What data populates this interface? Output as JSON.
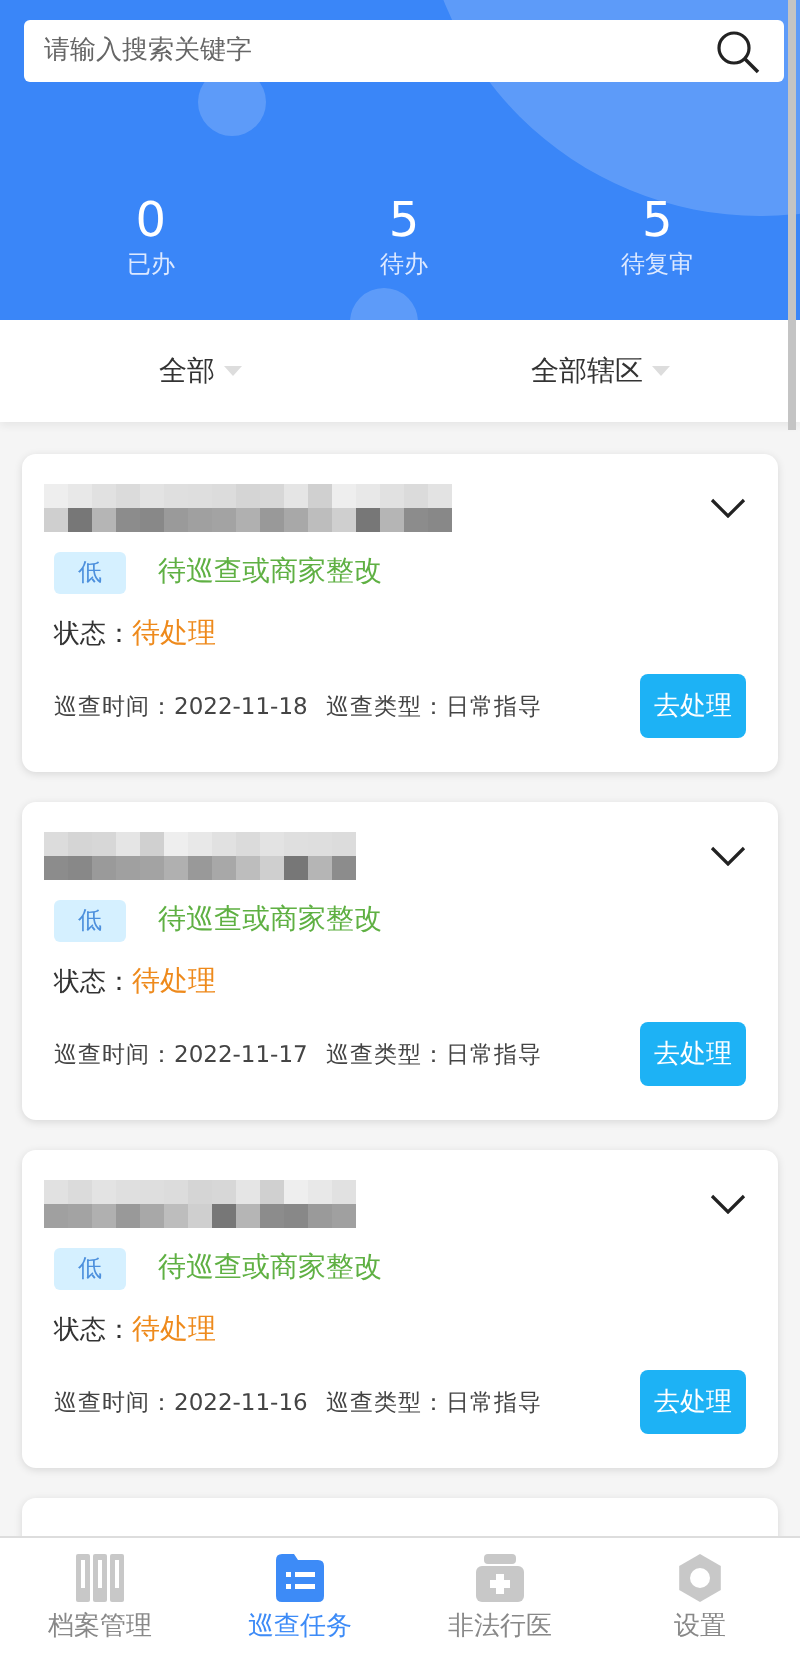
{
  "search": {
    "placeholder": "请输入搜索关键字"
  },
  "stats": [
    {
      "value": "0",
      "label": "已办"
    },
    {
      "value": "5",
      "label": "待办"
    },
    {
      "value": "5",
      "label": "待复审"
    }
  ],
  "filters": [
    {
      "label": "全部"
    },
    {
      "label": "全部辖区"
    }
  ],
  "records": [
    {
      "priority": "低",
      "stage": "待巡查或商家整改",
      "status_label": "状态：",
      "status": "待处理",
      "time_label": "巡查时间：",
      "time": "2022-11-18",
      "type_label": "巡查类型：",
      "type": "日常指导",
      "action": "去处理"
    },
    {
      "priority": "低",
      "stage": "待巡查或商家整改",
      "status_label": "状态：",
      "status": "待处理",
      "time_label": "巡查时间：",
      "time": "2022-11-17",
      "type_label": "巡查类型：",
      "type": "日常指导",
      "action": "去处理"
    },
    {
      "priority": "低",
      "stage": "待巡查或商家整改",
      "status_label": "状态：",
      "status": "待处理",
      "time_label": "巡查时间：",
      "time": "2022-11-16",
      "type_label": "巡查类型：",
      "type": "日常指导",
      "action": "去处理"
    }
  ],
  "tabs": [
    {
      "label": "档案管理",
      "kind": "binders",
      "selected": false
    },
    {
      "label": "巡查任务",
      "kind": "folder",
      "selected": true
    },
    {
      "label": "非法行医",
      "kind": "medkit",
      "selected": false
    },
    {
      "label": "设置",
      "kind": "hexagon",
      "selected": false
    }
  ]
}
